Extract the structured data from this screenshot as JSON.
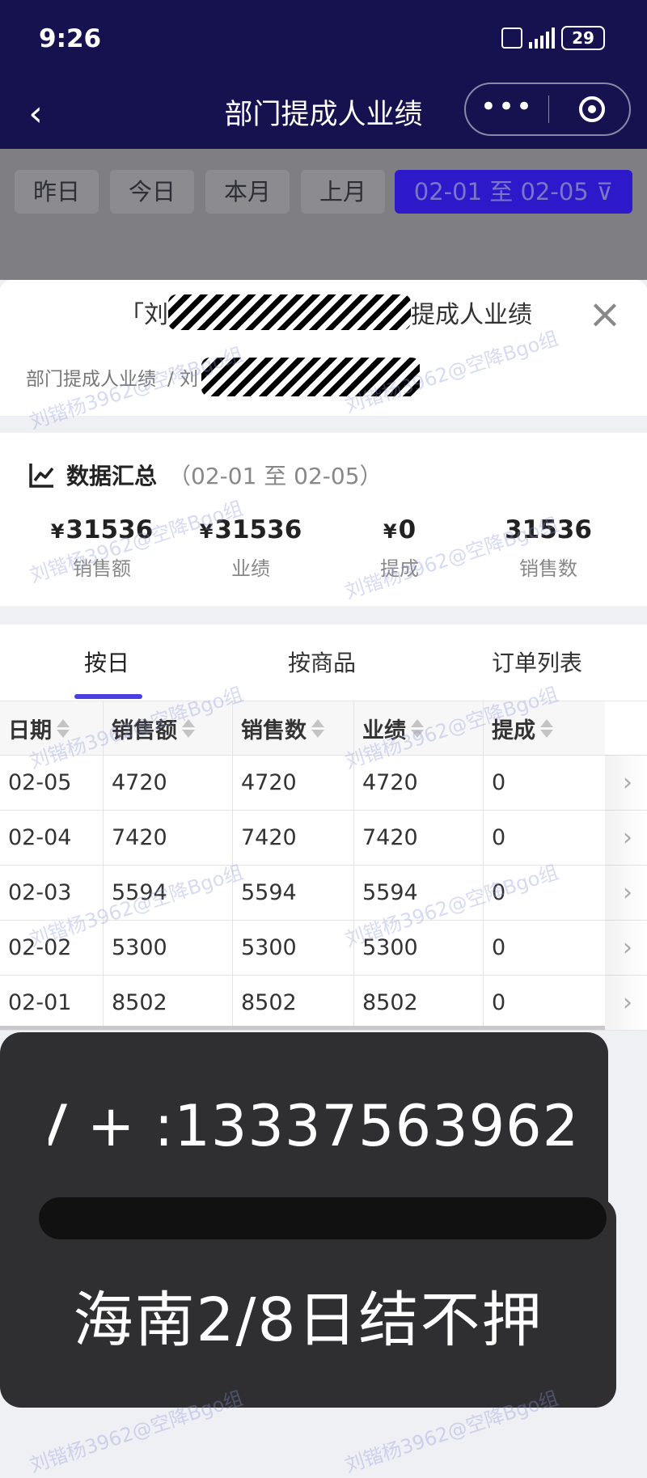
{
  "status_bar": {
    "time": "9:26",
    "battery": "29"
  },
  "nav": {
    "title": "部门提成人业绩",
    "more": "•••"
  },
  "filters": [
    {
      "label": "昨日"
    },
    {
      "label": "今日"
    },
    {
      "label": "本月"
    },
    {
      "label": "上月"
    },
    {
      "label": "02-01 至 02-05 ⊽"
    }
  ],
  "sheet": {
    "title_prefix": "「刘",
    "title_suffix": "提成人业绩",
    "breadcrumb_root": "部门提成人业绩",
    "breadcrumb_sep": "/ 刘",
    "close": "×"
  },
  "summary": {
    "title": "数据汇总",
    "range": "（02-01 至 02-05）",
    "currency": "¥",
    "metrics": [
      {
        "value": "31536",
        "label": "销售额",
        "currency": true
      },
      {
        "value": "31536",
        "label": "业绩",
        "currency": true
      },
      {
        "value": "0",
        "label": "提成",
        "currency": true
      },
      {
        "value": "31536",
        "label": "销售数",
        "currency": false
      }
    ]
  },
  "tabs": [
    {
      "label": "按日",
      "active": true
    },
    {
      "label": "按商品",
      "active": false
    },
    {
      "label": "订单列表",
      "active": false
    }
  ],
  "table": {
    "columns": [
      "日期",
      "销售额",
      "销售数",
      "业绩",
      "提成"
    ],
    "rows": [
      [
        "02-05",
        "4720",
        "4720",
        "4720",
        "0"
      ],
      [
        "02-04",
        "7420",
        "7420",
        "7420",
        "0"
      ],
      [
        "02-03",
        "5594",
        "5594",
        "5594",
        "0"
      ],
      [
        "02-02",
        "5300",
        "5300",
        "5300",
        "0"
      ],
      [
        "02-01",
        "8502",
        "8502",
        "8502",
        "0"
      ]
    ],
    "chevron": "›"
  },
  "overlay": {
    "line1": "V + :13337563962",
    "line2": "海南2/8日结不押"
  },
  "watermark": "刘锴杨3962@空降Bgo组"
}
